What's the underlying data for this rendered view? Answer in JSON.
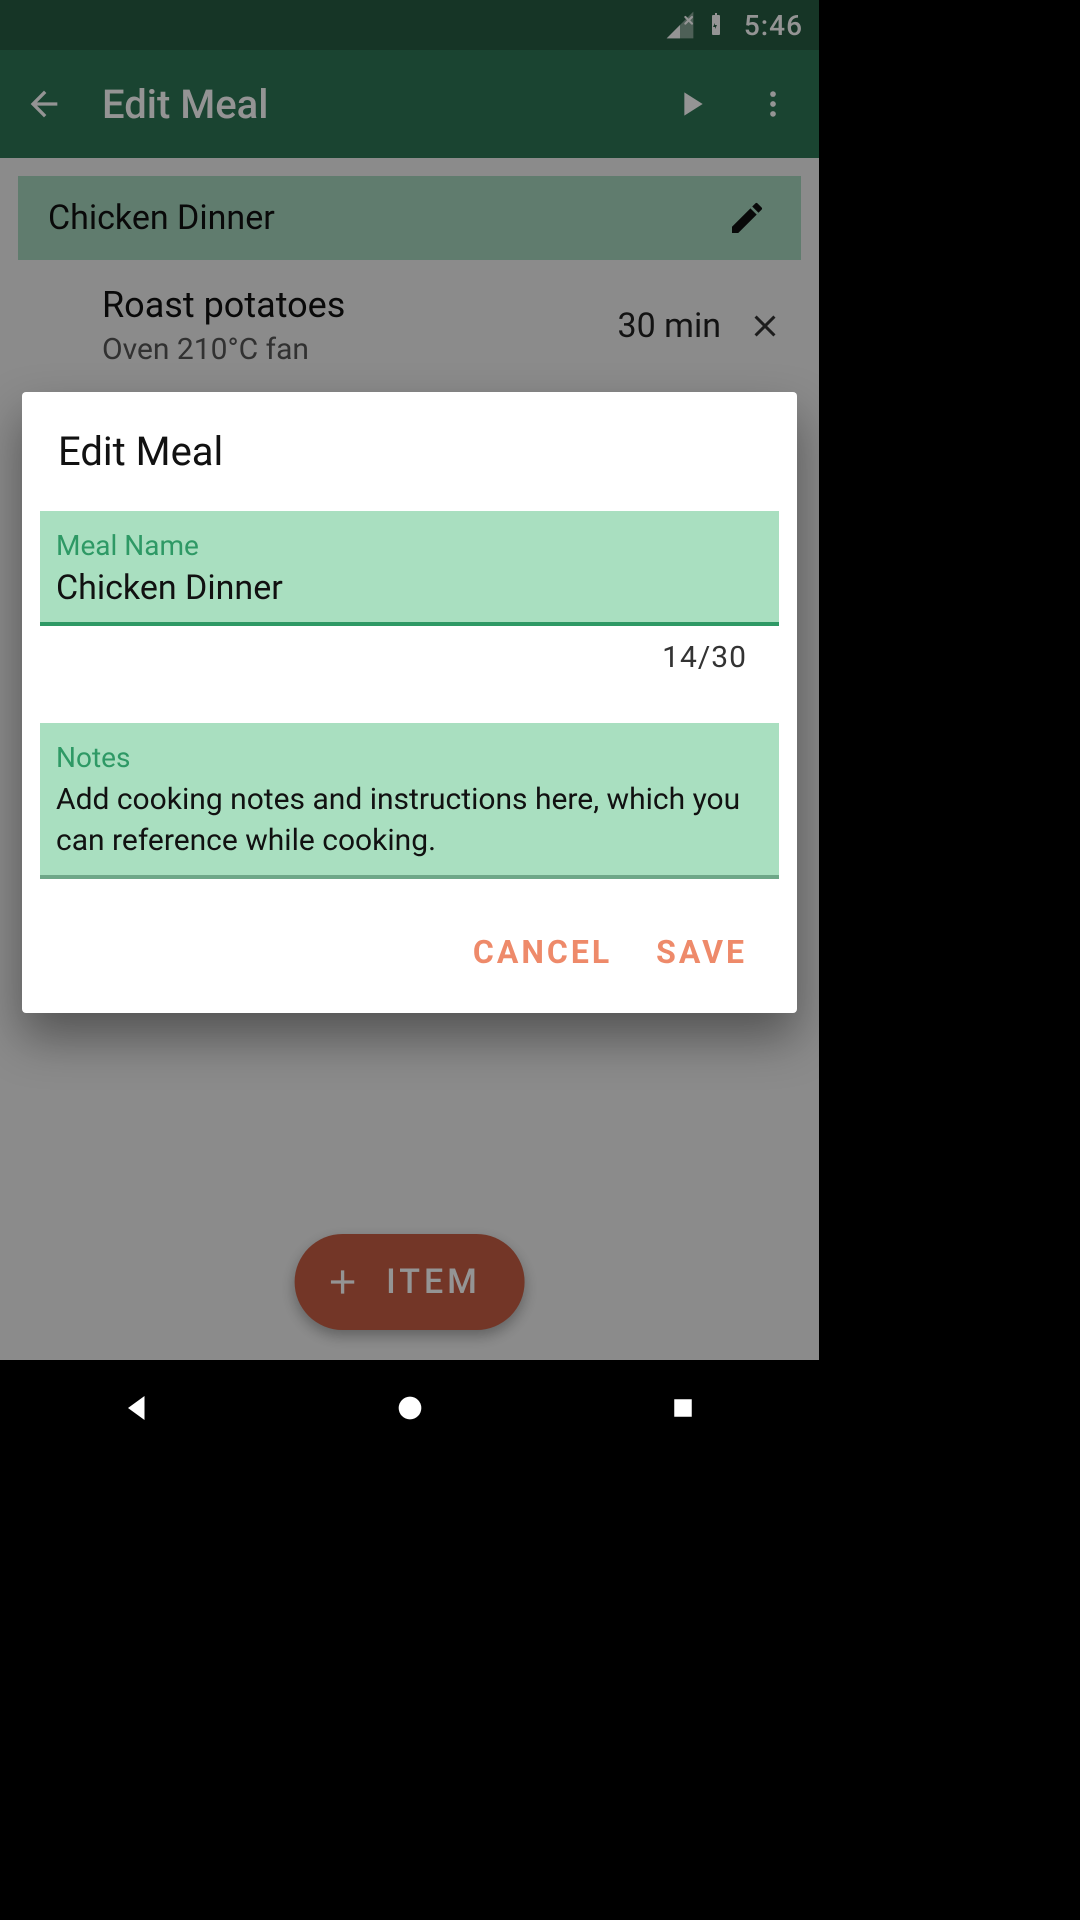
{
  "status_bar": {
    "time": "5:46"
  },
  "toolbar": {
    "title": "Edit Meal"
  },
  "meal": {
    "name": "Chicken Dinner"
  },
  "item": {
    "name": "Roast potatoes",
    "subtitle": "Oven 210°C fan",
    "duration": "30 min"
  },
  "fab": {
    "label": "ITEM"
  },
  "dialog": {
    "title": "Edit Meal",
    "meal_name_label": "Meal Name",
    "meal_name_value": "Chicken Dinner",
    "counter": "14/30",
    "notes_label": "Notes",
    "notes_hint": "Add cooking notes and instructions here, which you can reference while cooking.",
    "cancel": "CANCEL",
    "save": "SAVE"
  }
}
